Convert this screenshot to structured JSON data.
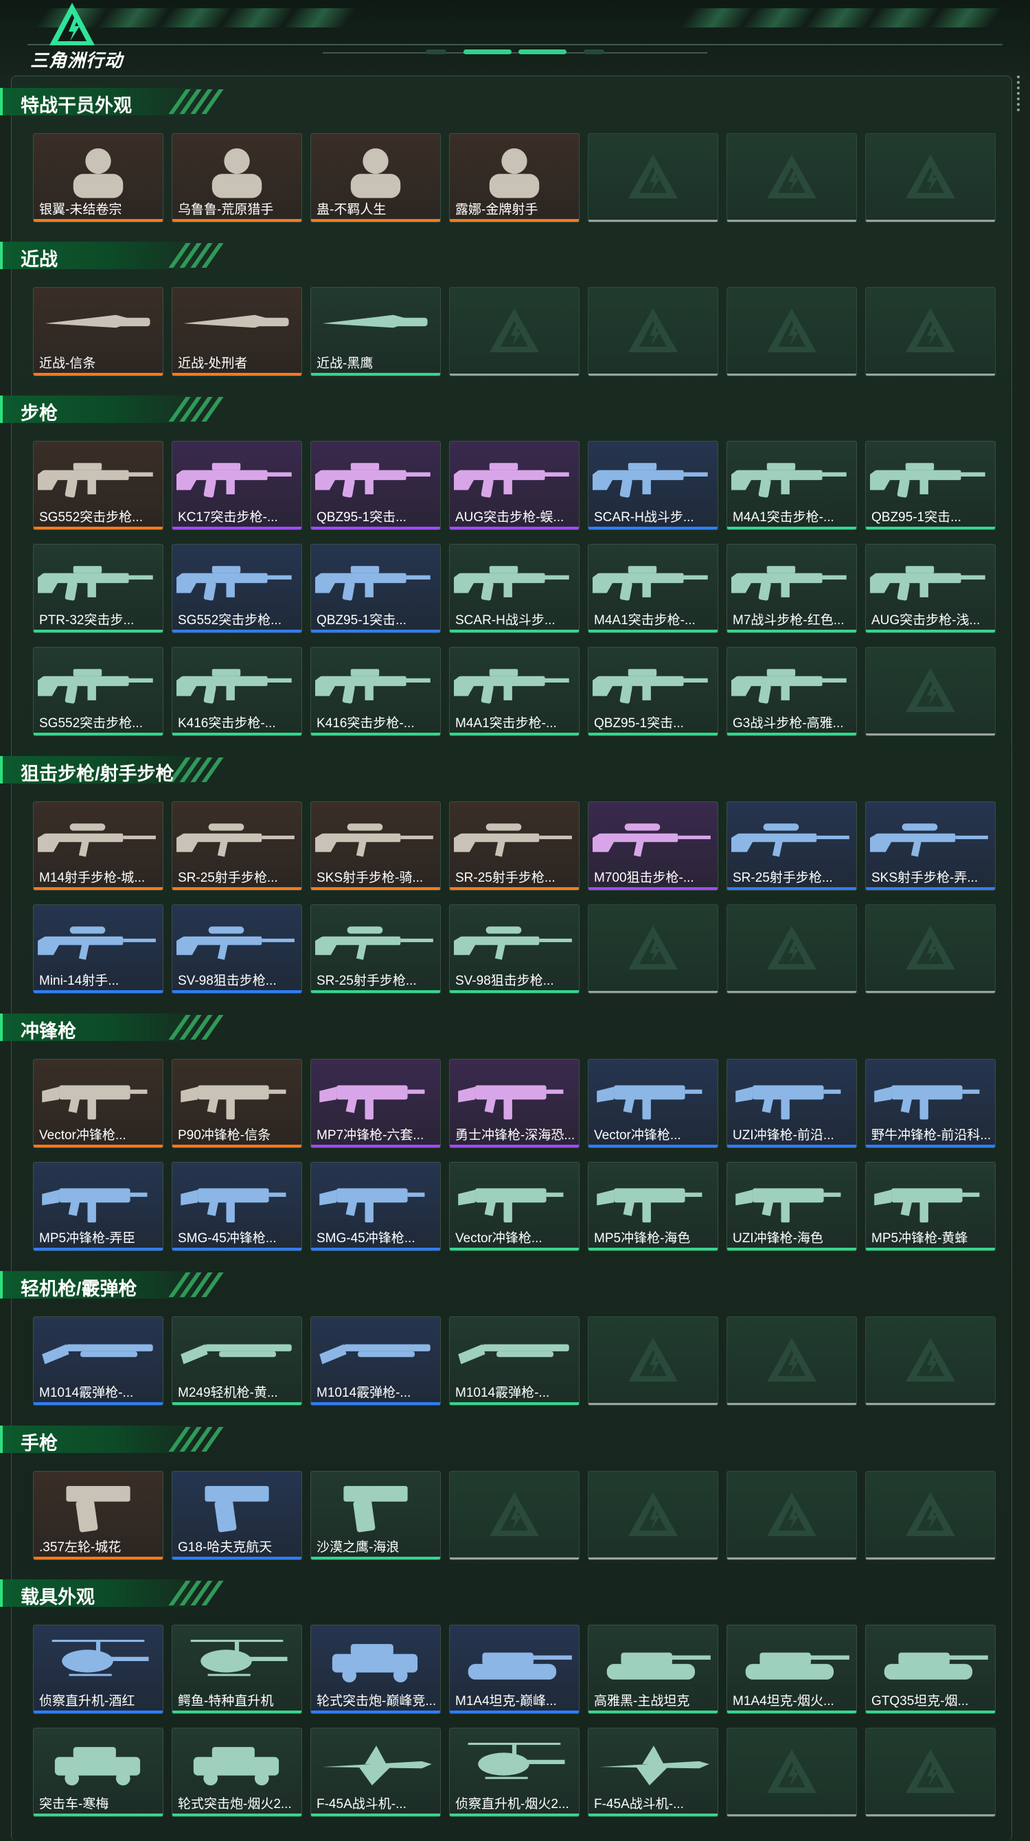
{
  "logo": {
    "name": "三角洲行动",
    "icon": "delta-triangle-logo-icon"
  },
  "colors": {
    "accent": "#33d18b",
    "rarity": {
      "orange": "#ff7a1c",
      "purple": "#9c4dff",
      "blue": "#2f7dff",
      "green": "#35d68c",
      "gray": "#9aa39e"
    }
  },
  "sections": [
    {
      "title": "特战干员外观",
      "items": [
        {
          "label": "银翼-未结卷宗",
          "rarity": "orange",
          "icon": "operator-portrait-icon"
        },
        {
          "label": "乌鲁鲁-荒原猎手",
          "rarity": "orange",
          "icon": "operator-portrait-icon"
        },
        {
          "label": "蛊-不羁人生",
          "rarity": "orange",
          "icon": "operator-portrait-icon"
        },
        {
          "label": "露娜-金牌射手",
          "rarity": "orange",
          "icon": "operator-portrait-icon"
        },
        {
          "label": "",
          "rarity": "empty"
        },
        {
          "label": "",
          "rarity": "empty"
        },
        {
          "label": "",
          "rarity": "empty"
        }
      ]
    },
    {
      "title": "近战",
      "items": [
        {
          "label": "近战-信条",
          "rarity": "orange",
          "icon": "knife-icon"
        },
        {
          "label": "近战-处刑者",
          "rarity": "orange",
          "icon": "knife-icon"
        },
        {
          "label": "近战-黑鹰",
          "rarity": "green",
          "icon": "knife-icon"
        },
        {
          "label": "",
          "rarity": "empty"
        },
        {
          "label": "",
          "rarity": "empty"
        },
        {
          "label": "",
          "rarity": "empty"
        },
        {
          "label": "",
          "rarity": "empty"
        }
      ]
    },
    {
      "title": "步枪",
      "items": [
        {
          "label": "SG552突击步枪...",
          "rarity": "orange",
          "icon": "rifle-icon"
        },
        {
          "label": "KC17突击步枪-...",
          "rarity": "purple",
          "icon": "rifle-icon"
        },
        {
          "label": "QBZ95-1突击...",
          "rarity": "purple",
          "icon": "rifle-icon"
        },
        {
          "label": "AUG突击步枪-蜈...",
          "rarity": "purple",
          "icon": "rifle-icon"
        },
        {
          "label": "SCAR-H战斗步...",
          "rarity": "blue",
          "icon": "rifle-icon"
        },
        {
          "label": "M4A1突击步枪-...",
          "rarity": "green",
          "icon": "rifle-icon"
        },
        {
          "label": "QBZ95-1突击...",
          "rarity": "green",
          "icon": "rifle-icon"
        },
        {
          "label": "PTR-32突击步...",
          "rarity": "green",
          "icon": "rifle-icon"
        },
        {
          "label": "SG552突击步枪...",
          "rarity": "blue",
          "icon": "rifle-icon"
        },
        {
          "label": "QBZ95-1突击...",
          "rarity": "blue",
          "icon": "rifle-icon"
        },
        {
          "label": "SCAR-H战斗步...",
          "rarity": "green",
          "icon": "rifle-icon"
        },
        {
          "label": "M4A1突击步枪-...",
          "rarity": "green",
          "icon": "rifle-icon"
        },
        {
          "label": "M7战斗步枪-红色...",
          "rarity": "green",
          "icon": "rifle-icon"
        },
        {
          "label": "AUG突击步枪-浅...",
          "rarity": "green",
          "icon": "rifle-icon"
        },
        {
          "label": "SG552突击步枪...",
          "rarity": "green",
          "icon": "rifle-icon"
        },
        {
          "label": "K416突击步枪-...",
          "rarity": "green",
          "icon": "rifle-icon"
        },
        {
          "label": "K416突击步枪-...",
          "rarity": "green",
          "icon": "rifle-icon"
        },
        {
          "label": "M4A1突击步枪-...",
          "rarity": "green",
          "icon": "rifle-icon"
        },
        {
          "label": "QBZ95-1突击...",
          "rarity": "green",
          "icon": "rifle-icon"
        },
        {
          "label": "G3战斗步枪-高雅...",
          "rarity": "green",
          "icon": "rifle-icon"
        },
        {
          "label": "",
          "rarity": "empty"
        }
      ]
    },
    {
      "title": "狙击步枪/射手步枪",
      "items": [
        {
          "label": "M14射手步枪-城...",
          "rarity": "orange",
          "icon": "sniper-rifle-icon"
        },
        {
          "label": "SR-25射手步枪...",
          "rarity": "orange",
          "icon": "sniper-rifle-icon"
        },
        {
          "label": "SKS射手步枪-骑...",
          "rarity": "orange",
          "icon": "sniper-rifle-icon"
        },
        {
          "label": "SR-25射手步枪...",
          "rarity": "orange",
          "icon": "sniper-rifle-icon"
        },
        {
          "label": "M700狙击步枪-...",
          "rarity": "purple",
          "icon": "sniper-rifle-icon"
        },
        {
          "label": "SR-25射手步枪...",
          "rarity": "blue",
          "icon": "sniper-rifle-icon"
        },
        {
          "label": "SKS射手步枪-弄...",
          "rarity": "blue",
          "icon": "sniper-rifle-icon"
        },
        {
          "label": "Mini-14射手...",
          "rarity": "blue",
          "icon": "sniper-rifle-icon"
        },
        {
          "label": "SV-98狙击步枪...",
          "rarity": "blue",
          "icon": "sniper-rifle-icon"
        },
        {
          "label": "SR-25射手步枪...",
          "rarity": "green",
          "icon": "sniper-rifle-icon"
        },
        {
          "label": "SV-98狙击步枪...",
          "rarity": "green",
          "icon": "sniper-rifle-icon"
        },
        {
          "label": "",
          "rarity": "empty"
        },
        {
          "label": "",
          "rarity": "empty"
        },
        {
          "label": "",
          "rarity": "empty"
        }
      ]
    },
    {
      "title": "冲锋枪",
      "items": [
        {
          "label": "Vector冲锋枪...",
          "rarity": "orange",
          "icon": "smg-icon"
        },
        {
          "label": "P90冲锋枪-信条",
          "rarity": "orange",
          "icon": "smg-icon"
        },
        {
          "label": "MP7冲锋枪-六套...",
          "rarity": "purple",
          "icon": "smg-icon"
        },
        {
          "label": "勇士冲锋枪-深海恐...",
          "rarity": "purple",
          "icon": "smg-icon"
        },
        {
          "label": "Vector冲锋枪...",
          "rarity": "blue",
          "icon": "smg-icon"
        },
        {
          "label": "UZI冲锋枪-前沿...",
          "rarity": "blue",
          "icon": "smg-icon"
        },
        {
          "label": "野牛冲锋枪-前沿科...",
          "rarity": "blue",
          "icon": "smg-icon"
        },
        {
          "label": "MP5冲锋枪-弄臣",
          "rarity": "blue",
          "icon": "smg-icon"
        },
        {
          "label": "SMG-45冲锋枪...",
          "rarity": "blue",
          "icon": "smg-icon"
        },
        {
          "label": "SMG-45冲锋枪...",
          "rarity": "blue",
          "icon": "smg-icon"
        },
        {
          "label": "Vector冲锋枪...",
          "rarity": "green",
          "icon": "smg-icon"
        },
        {
          "label": "MP5冲锋枪-海色",
          "rarity": "green",
          "icon": "smg-icon"
        },
        {
          "label": "UZI冲锋枪-海色",
          "rarity": "green",
          "icon": "smg-icon"
        },
        {
          "label": "MP5冲锋枪-黄蜂",
          "rarity": "green",
          "icon": "smg-icon"
        }
      ]
    },
    {
      "title": "轻机枪/霰弹枪",
      "items": [
        {
          "label": "M1014霰弹枪-...",
          "rarity": "blue",
          "icon": "shotgun-icon"
        },
        {
          "label": "M249轻机枪-黄...",
          "rarity": "green",
          "icon": "machine-gun-icon"
        },
        {
          "label": "M1014霰弹枪-...",
          "rarity": "blue",
          "icon": "shotgun-icon"
        },
        {
          "label": "M1014霰弹枪-...",
          "rarity": "green",
          "icon": "shotgun-icon"
        },
        {
          "label": "",
          "rarity": "empty"
        },
        {
          "label": "",
          "rarity": "empty"
        },
        {
          "label": "",
          "rarity": "empty"
        }
      ]
    },
    {
      "title": "手枪",
      "items": [
        {
          "label": ".357左轮-城花",
          "rarity": "orange",
          "icon": "revolver-icon"
        },
        {
          "label": "G18-哈夫克航天",
          "rarity": "blue",
          "icon": "pistol-icon"
        },
        {
          "label": "沙漠之鹰-海浪",
          "rarity": "green",
          "icon": "pistol-icon"
        },
        {
          "label": "",
          "rarity": "empty"
        },
        {
          "label": "",
          "rarity": "empty"
        },
        {
          "label": "",
          "rarity": "empty"
        },
        {
          "label": "",
          "rarity": "empty"
        }
      ]
    },
    {
      "title": "载具外观",
      "items": [
        {
          "label": "侦察直升机-酒红",
          "rarity": "blue",
          "icon": "helicopter-icon"
        },
        {
          "label": "鳄鱼-特种直升机",
          "rarity": "green",
          "icon": "helicopter-icon"
        },
        {
          "label": "轮式突击炮-巅峰竞...",
          "rarity": "blue",
          "icon": "armored-vehicle-icon"
        },
        {
          "label": "M1A4坦克-巅峰...",
          "rarity": "blue",
          "icon": "tank-icon"
        },
        {
          "label": "高雅黑-主战坦克",
          "rarity": "green",
          "icon": "tank-icon"
        },
        {
          "label": "M1A4坦克-烟火...",
          "rarity": "green",
          "icon": "tank-icon"
        },
        {
          "label": "GTQ35坦克-烟...",
          "rarity": "green",
          "icon": "tank-icon"
        },
        {
          "label": "突击车-寒梅",
          "rarity": "green",
          "icon": "assault-vehicle-icon"
        },
        {
          "label": "轮式突击炮-烟火2...",
          "rarity": "green",
          "icon": "armored-vehicle-icon"
        },
        {
          "label": "F-45A战斗机-...",
          "rarity": "green",
          "icon": "fighter-jet-icon"
        },
        {
          "label": "侦察直升机-烟火2...",
          "rarity": "green",
          "icon": "helicopter-icon"
        },
        {
          "label": "F-45A战斗机-...",
          "rarity": "green",
          "icon": "fighter-jet-icon"
        },
        {
          "label": "",
          "rarity": "empty"
        },
        {
          "label": "",
          "rarity": "empty"
        }
      ]
    }
  ]
}
